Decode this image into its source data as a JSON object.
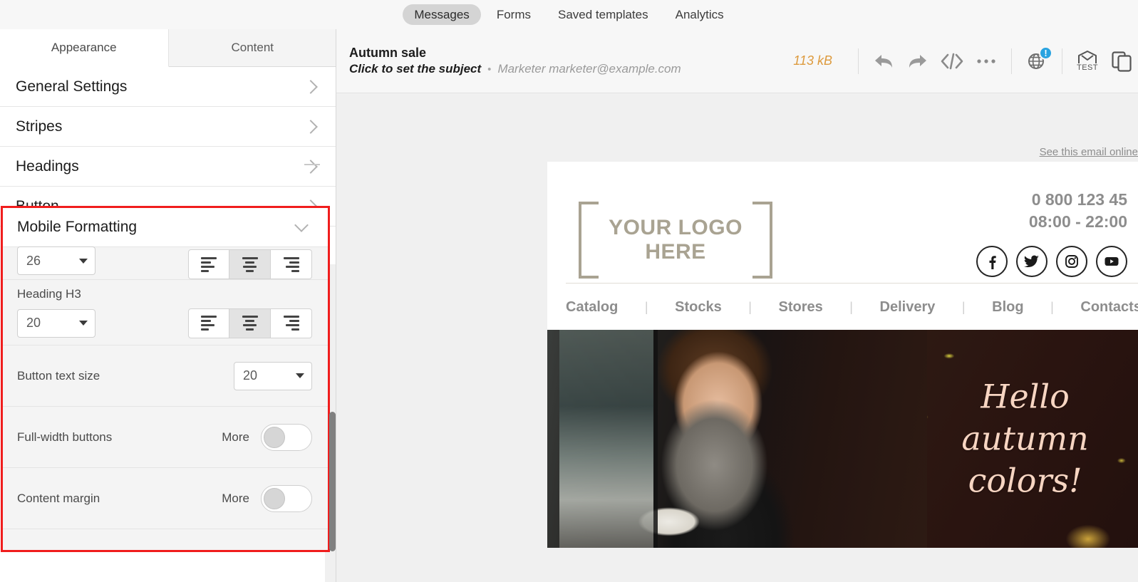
{
  "topnav": {
    "items": [
      {
        "label": "Messages",
        "active": true
      },
      {
        "label": "Forms",
        "active": false
      },
      {
        "label": "Saved templates",
        "active": false
      },
      {
        "label": "Analytics",
        "active": false
      }
    ]
  },
  "left_panel": {
    "tabs": [
      {
        "label": "Appearance",
        "active": true
      },
      {
        "label": "Content",
        "active": false
      }
    ],
    "sections": [
      {
        "label": "General Settings"
      },
      {
        "label": "Stripes"
      },
      {
        "label": "Headings"
      },
      {
        "label": "Button"
      }
    ],
    "mobile_formatting": {
      "title": "Mobile Formatting",
      "rows": {
        "clipped_size_value": "26",
        "heading_h3_label": "Heading H3",
        "heading_h3_value": "20",
        "button_text_size_label": "Button text size",
        "button_text_size_value": "20",
        "full_width_buttons_label": "Full-width buttons",
        "full_width_buttons_more": "More",
        "content_margin_label": "Content margin",
        "content_margin_more": "More"
      },
      "alignment_options": [
        "left",
        "center",
        "right"
      ],
      "alignment_selected": "center",
      "highlight_color": "#f01d1d"
    }
  },
  "email_header": {
    "title": "Autumn sale",
    "subject_placeholder": "Click to set the subject",
    "separator": "•",
    "sender": "Marketer marketer@example.com",
    "size": "113 kB",
    "size_color": "#dd9a3d",
    "tools": [
      {
        "name": "undo-icon"
      },
      {
        "name": "redo-icon"
      },
      {
        "name": "code-icon",
        "label": "</>"
      },
      {
        "name": "more-icon",
        "label": "•••"
      },
      {
        "name": "globe-icon",
        "badge": "!",
        "badge_color": "#29a3e0"
      },
      {
        "name": "test-email-icon",
        "label": "TEST"
      },
      {
        "name": "duplicate-icon"
      }
    ]
  },
  "canvas": {
    "see_online": "See this email online",
    "email": {
      "logo_text": "YOUR LOGO HERE",
      "phone": "0 800 123 45",
      "hours": "08:00 - 22:00",
      "socials": [
        "facebook-icon",
        "twitter-icon",
        "instagram-icon",
        "youtube-icon"
      ],
      "nav": [
        "Catalog",
        "Stocks",
        "Stores",
        "Delivery",
        "Blog",
        "Contacts"
      ],
      "nav_separator": "|",
      "hero_text_line1": "Hello",
      "hero_text_line2": "autumn",
      "hero_text_line3": "colors!",
      "hero_text_color": "#f7d5c2"
    }
  }
}
